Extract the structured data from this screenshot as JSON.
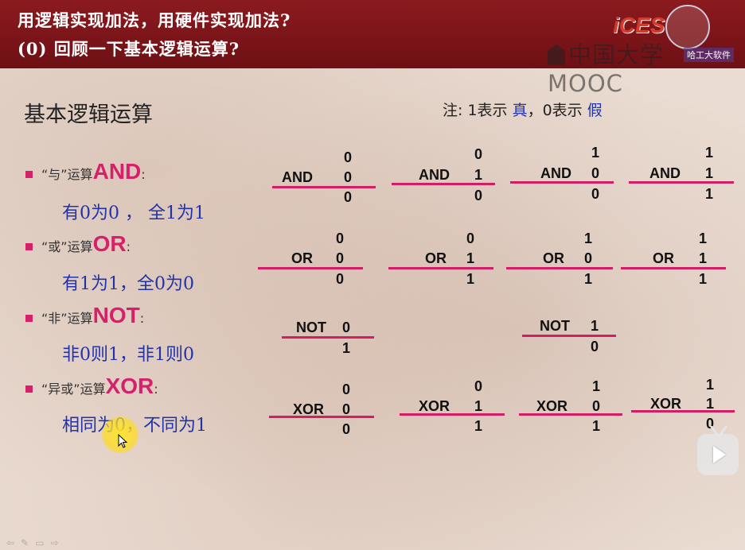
{
  "header": {
    "title_line1": "用逻辑实现加法，用硬件实现加法?",
    "title_line2": "(0) 回顾一下基本逻辑运算?",
    "logo_text": "iCES",
    "mooc_text": "中国大学MOOC",
    "logo_caption": "哈工大软件"
  },
  "slide": {
    "section_title": "基本逻辑运算",
    "note_prefix": "注: 1表示 ",
    "note_true": "真",
    "note_mid": "，0表示 ",
    "note_false": "假"
  },
  "ops": [
    {
      "quote": "“与”运算",
      "keyword": "AND",
      "colon": ":",
      "rule": "有0为0 ， 全1为1"
    },
    {
      "quote": "“或”运算",
      "keyword": "OR",
      "colon": ":",
      "rule": "有1为1，全0为0"
    },
    {
      "quote": "“非”运算",
      "keyword": "NOT",
      "colon": ":",
      "rule": "非0则1，非1则0"
    },
    {
      "quote": "“异或”运算",
      "keyword": "XOR",
      "colon": ":",
      "rule": "相同为0，不同为1"
    }
  ],
  "tables": {
    "and": [
      {
        "op": "AND",
        "a": "0",
        "b": "0",
        "r": "0"
      },
      {
        "op": "AND",
        "a": "0",
        "b": "1",
        "r": "0"
      },
      {
        "op": "AND",
        "a": "1",
        "b": "0",
        "r": "0"
      },
      {
        "op": "AND",
        "a": "1",
        "b": "1",
        "r": "1"
      }
    ],
    "or": [
      {
        "op": "OR",
        "a": "0",
        "b": "0",
        "r": "0"
      },
      {
        "op": "OR",
        "a": "0",
        "b": "1",
        "r": "1"
      },
      {
        "op": "OR",
        "a": "1",
        "b": "0",
        "r": "1"
      },
      {
        "op": "OR",
        "a": "1",
        "b": "1",
        "r": "1"
      }
    ],
    "not": [
      {
        "op": "NOT",
        "b": "0",
        "r": "1"
      },
      {
        "op": "NOT",
        "b": "1",
        "r": "0"
      }
    ],
    "xor": [
      {
        "op": "XOR",
        "a": "0",
        "b": "0",
        "r": "0"
      },
      {
        "op": "XOR",
        "a": "0",
        "b": "1",
        "r": "1"
      },
      {
        "op": "XOR",
        "a": "1",
        "b": "0",
        "r": "1"
      },
      {
        "op": "XOR",
        "a": "1",
        "b": "1",
        "r": "0"
      }
    ]
  },
  "icons": {
    "play": "play-icon",
    "cursor": "mouse-cursor-icon",
    "nav": [
      "prev-slide-icon",
      "pen-icon",
      "menu-icon",
      "next-slide-icon"
    ]
  },
  "colors": {
    "header": "#7a1418",
    "keyword": "#d6206a",
    "rule": "#2233aa",
    "bar": "#d31e66"
  }
}
